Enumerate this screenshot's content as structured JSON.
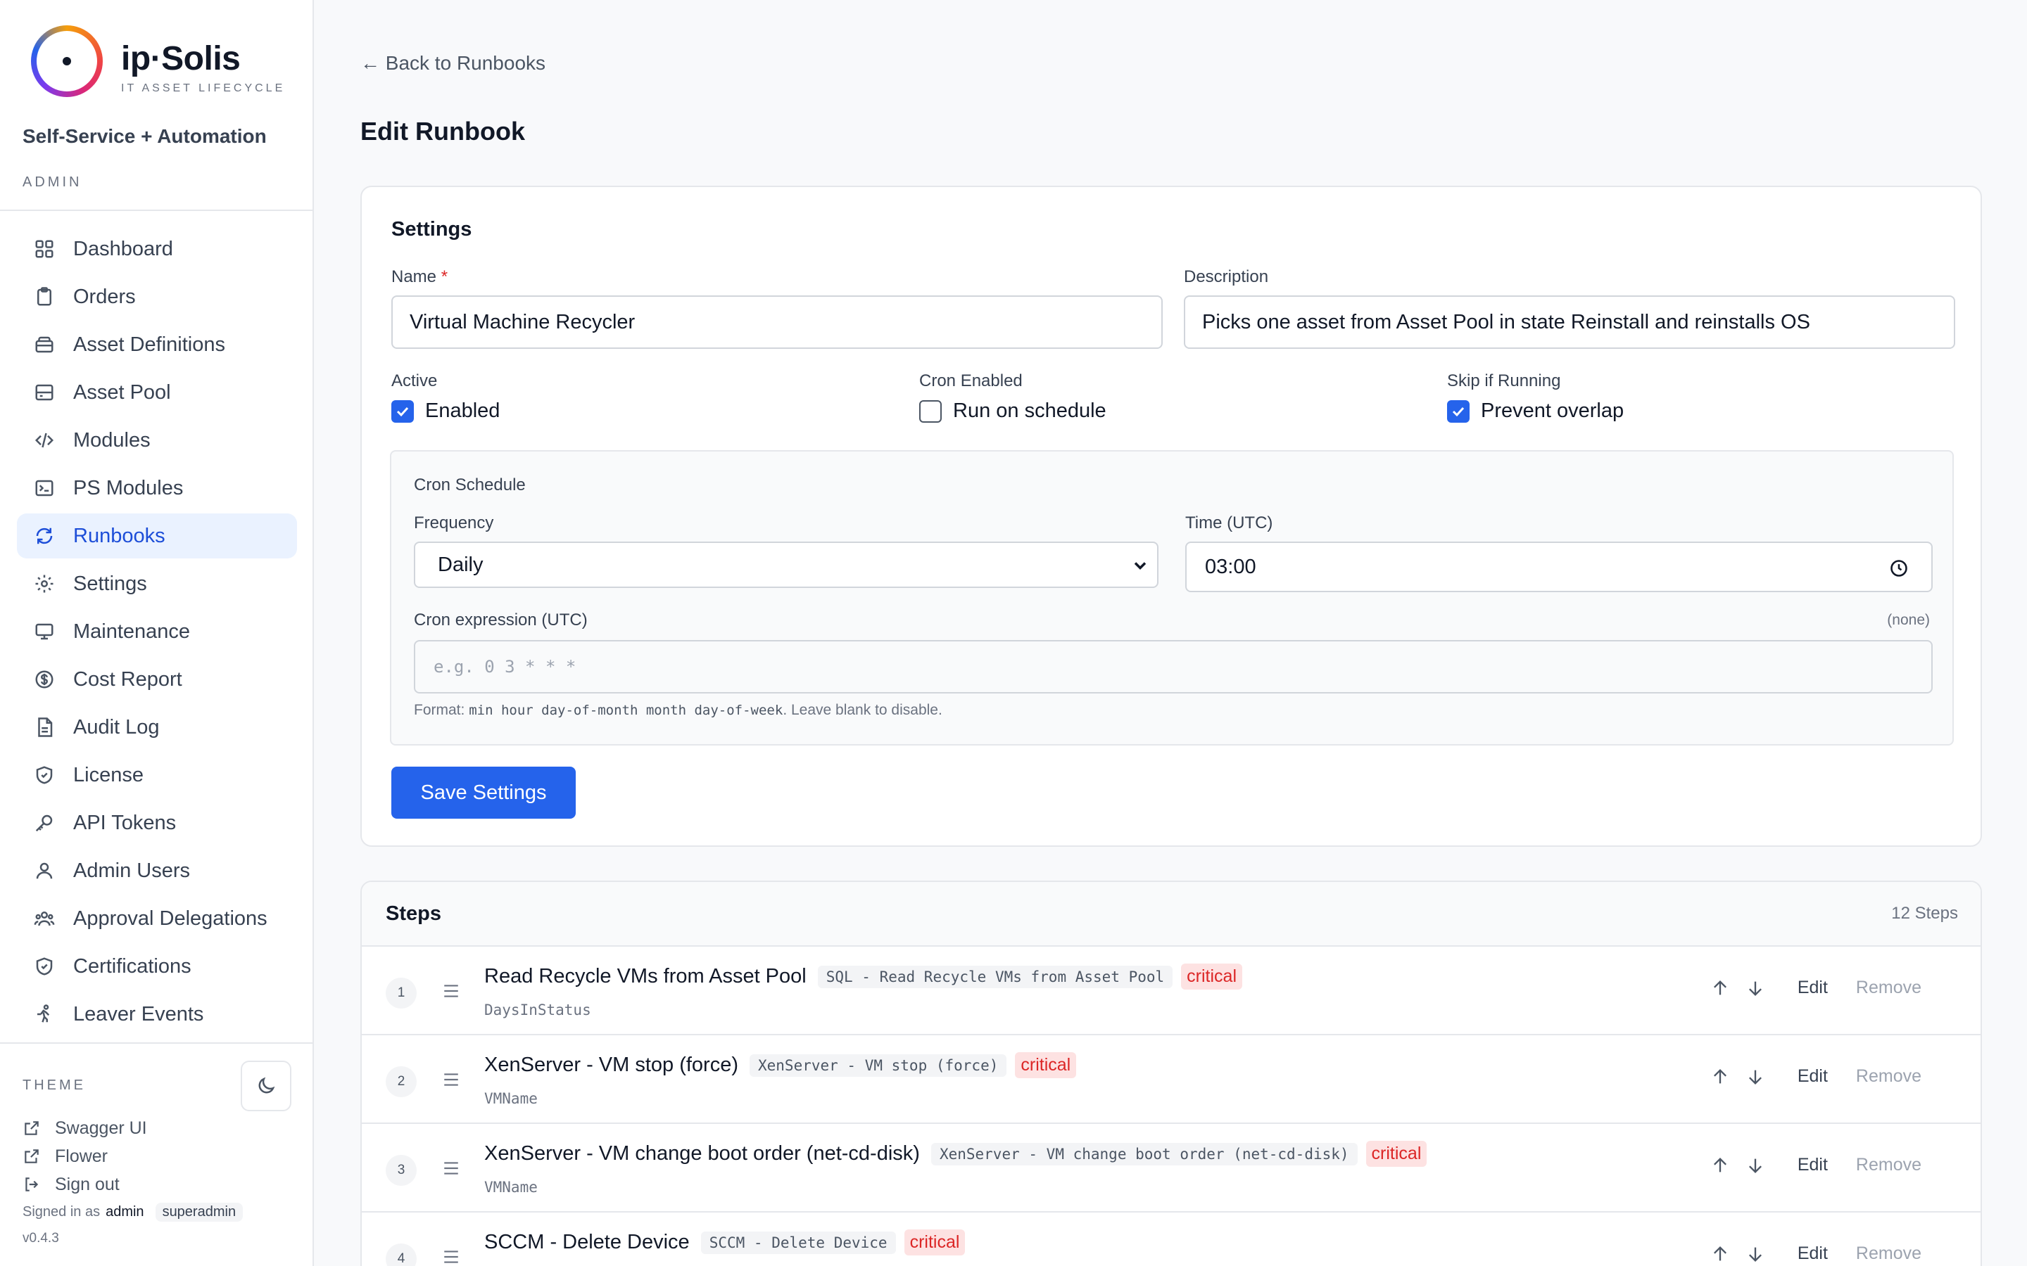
{
  "brand": {
    "name": "ip·Solis",
    "tagline": "IT ASSET LIFECYCLE"
  },
  "sidebar": {
    "portal_title": "Self-Service + Automation",
    "section_label": "ADMIN",
    "items": [
      {
        "label": "Dashboard",
        "icon": "dashboard-icon"
      },
      {
        "label": "Orders",
        "icon": "clipboard-icon"
      },
      {
        "label": "Asset Definitions",
        "icon": "package-icon"
      },
      {
        "label": "Asset Pool",
        "icon": "server-icon"
      },
      {
        "label": "Modules",
        "icon": "code-icon"
      },
      {
        "label": "PS Modules",
        "icon": "terminal-icon"
      },
      {
        "label": "Runbooks",
        "icon": "refresh-icon",
        "active": true
      },
      {
        "label": "Settings",
        "icon": "gear-icon"
      },
      {
        "label": "Maintenance",
        "icon": "monitor-icon"
      },
      {
        "label": "Cost Report",
        "icon": "dollar-icon"
      },
      {
        "label": "Audit Log",
        "icon": "file-icon"
      },
      {
        "label": "License",
        "icon": "shield-icon"
      },
      {
        "label": "API Tokens",
        "icon": "key-icon"
      },
      {
        "label": "Admin Users",
        "icon": "user-icon"
      },
      {
        "label": "Approval Delegations",
        "icon": "users-icon"
      },
      {
        "label": "Certifications",
        "icon": "shield-check-icon"
      },
      {
        "label": "Leaver Events",
        "icon": "walk-out-icon"
      }
    ],
    "theme_label": "THEME",
    "links": [
      {
        "label": "Swagger UI",
        "icon": "external-link-icon"
      },
      {
        "label": "Flower",
        "icon": "external-link-icon"
      },
      {
        "label": "Sign out",
        "icon": "sign-out-icon"
      }
    ],
    "signed_in_prefix": "Signed in as",
    "signed_in_user": "admin",
    "role": "superadmin",
    "version": "v0.4.3"
  },
  "page": {
    "back_link": "← Back to Runbooks",
    "title": "Edit Runbook"
  },
  "settings": {
    "title": "Settings",
    "name_label": "Name",
    "required_mark": "*",
    "name_value": "Virtual Machine Recycler",
    "description_label": "Description",
    "description_value": "Picks one asset from Asset Pool in state Reinstall and reinstalls OS",
    "active_label": "Active",
    "active_checkbox_label": "Enabled",
    "active_checked": true,
    "cron_enabled_label": "Cron Enabled",
    "cron_enabled_checkbox_label": "Run on schedule",
    "cron_enabled_checked": false,
    "skip_label": "Skip if Running",
    "skip_checkbox_label": "Prevent overlap",
    "skip_checked": true,
    "cron": {
      "title": "Cron Schedule",
      "frequency_label": "Frequency",
      "frequency_value": "Daily",
      "time_label": "Time (UTC)",
      "time_value": "03:00",
      "expression_label": "Cron expression (UTC)",
      "expression_hint": "(none)",
      "expression_placeholder": "e.g. 0 3 * * *",
      "format_prefix": "Format: ",
      "format_code": "min hour day-of-month month day-of-week",
      "format_suffix": ". Leave blank to disable."
    },
    "save_label": "Save Settings"
  },
  "steps": {
    "title": "Steps",
    "count": "12 Steps",
    "edit_label": "Edit",
    "remove_label": "Remove",
    "items": [
      {
        "num": "1",
        "name": "Read Recycle VMs from Asset Pool",
        "module": "SQL - Read Recycle VMs from Asset Pool",
        "badge": "critical",
        "param": "DaysInStatus"
      },
      {
        "num": "2",
        "name": "XenServer - VM stop (force)",
        "module": "XenServer - VM stop (force)",
        "badge": "critical",
        "param": "VMName"
      },
      {
        "num": "3",
        "name": "XenServer - VM change boot order (net-cd-disk)",
        "module": "XenServer - VM change boot order (net-cd-disk)",
        "badge": "critical",
        "param": "VMName"
      },
      {
        "num": "4",
        "name": "SCCM - Delete Device",
        "module": "SCCM - Delete Device",
        "badge": "critical",
        "param": ""
      }
    ]
  },
  "colors": {
    "accent": "#2563eb",
    "active_bg": "#eaf2ff",
    "critical_bg": "#fde2e2",
    "critical_text": "#dc2626"
  }
}
